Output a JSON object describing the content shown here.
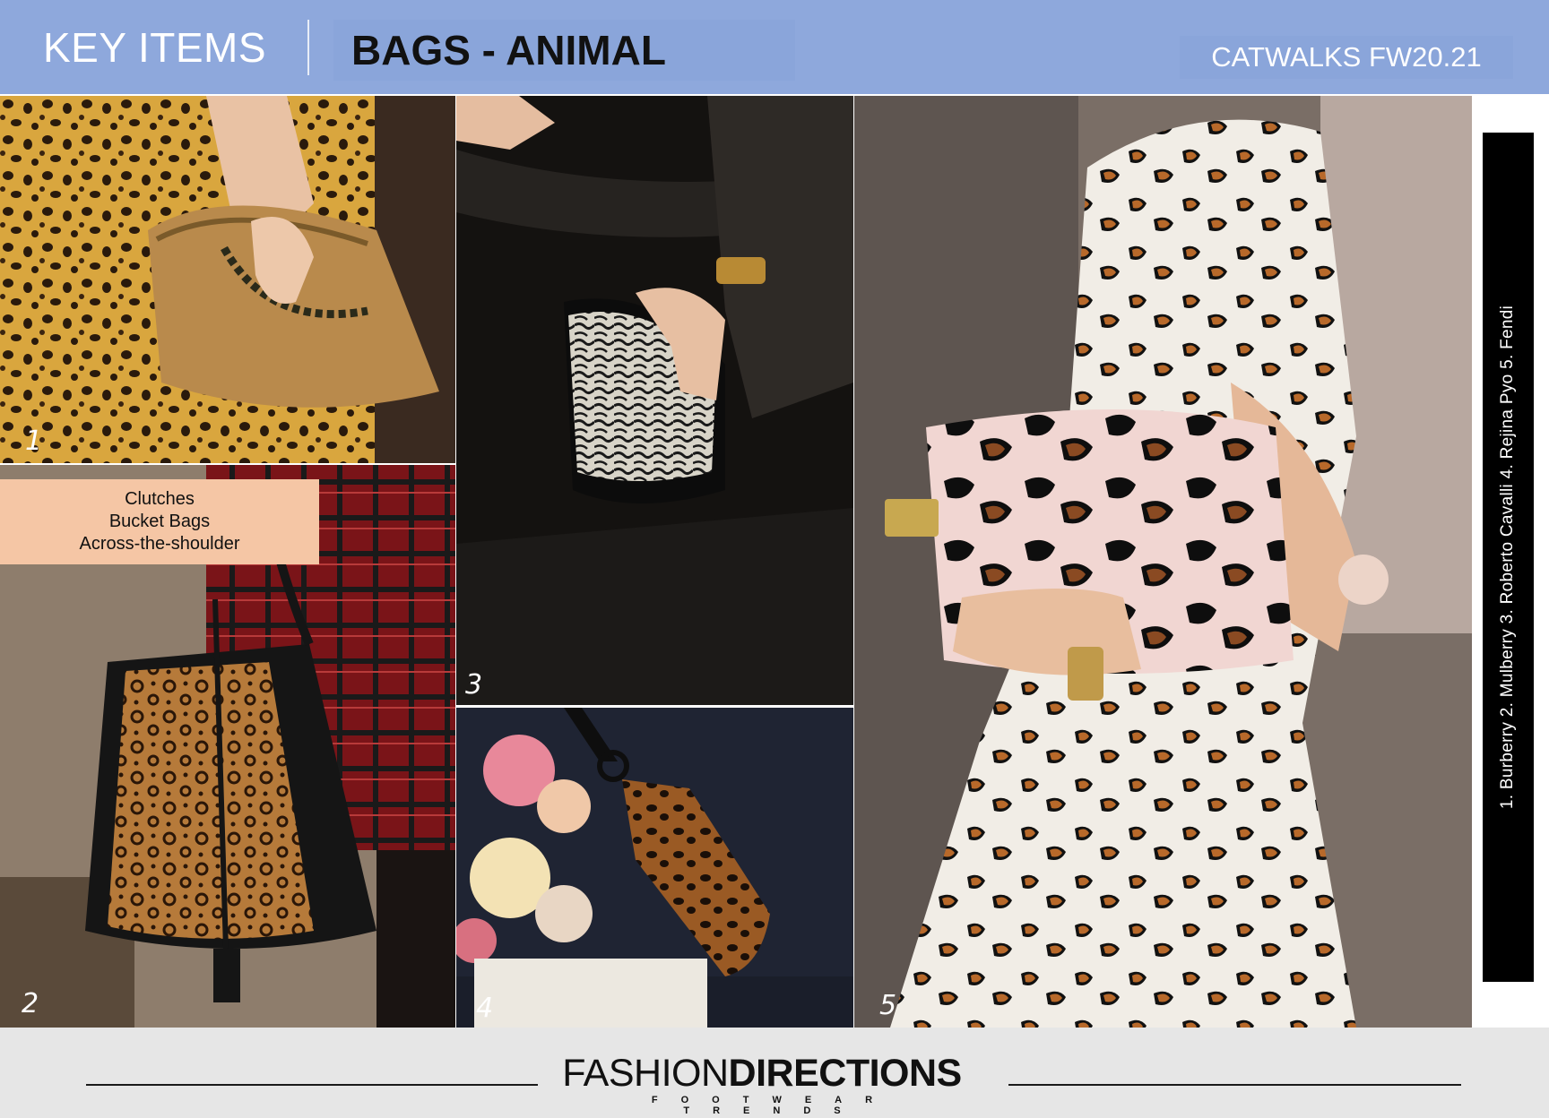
{
  "header": {
    "section_label": "KEY ITEMS",
    "title": "BAGS - ANIMAL",
    "season": "CATWALKS FW20.21"
  },
  "photos": [
    {
      "number": "1",
      "brand": "Burberry"
    },
    {
      "number": "2",
      "brand": "Mulberry"
    },
    {
      "number": "3",
      "brand": "Roberto Cavalli"
    },
    {
      "number": "4",
      "brand": "Rejina Pyo"
    },
    {
      "number": "5",
      "brand": "Fendi"
    }
  ],
  "keywords": {
    "line1": "Clutches",
    "line2": "Bucket Bags",
    "line3": "Across-the-shoulder"
  },
  "credits": "1. Burberry   2. Mulberry   3. Roberto Cavalli   4. Rejina Pyo   5. Fendi",
  "footer": {
    "brand_light": "FASHION",
    "brand_bold": "DIRECTIONS",
    "tagline": "FOOTWEAR TRENDS"
  },
  "colors": {
    "header_blue": "#8ea8dc",
    "keyword_peach": "#f5c6a5",
    "footer_gray": "#e6e6e6"
  }
}
